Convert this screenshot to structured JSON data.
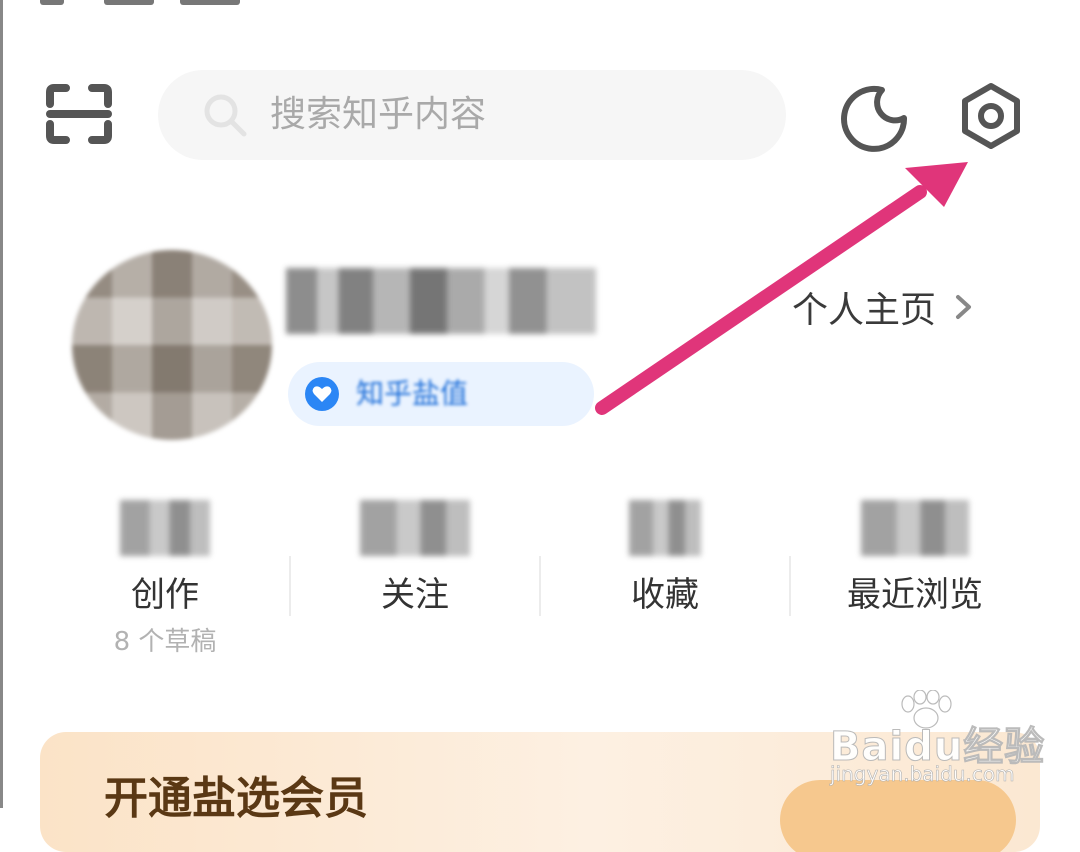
{
  "search": {
    "placeholder": "搜索知乎内容"
  },
  "profile": {
    "badge_text": "知乎盐值",
    "homepage_link": "个人主页"
  },
  "stats": [
    {
      "label": "创作",
      "sub": "8 个草稿"
    },
    {
      "label": "关注"
    },
    {
      "label": "收藏"
    },
    {
      "label": "最近浏览"
    }
  ],
  "vip": {
    "title": "开通盐选会员"
  },
  "watermark": {
    "main": "Baidu经验",
    "sub": "jingyan.baidu.com"
  },
  "colors": {
    "arrow": "#e0357a",
    "accent_blue": "#1e6fd9",
    "vip_bg": "#fbe3c7"
  },
  "icons": [
    "scan-icon",
    "search-icon",
    "moon-icon",
    "settings-icon",
    "heart-badge-icon",
    "chevron-right-icon",
    "paw-icon"
  ]
}
